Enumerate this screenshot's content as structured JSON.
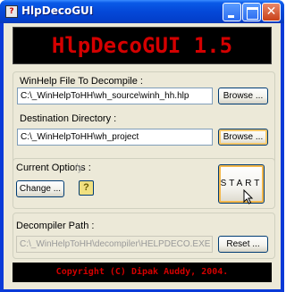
{
  "window": {
    "title": "HlpDecoGUI",
    "icon": "help-decompiler-icon",
    "controls": [
      "minimize-icon",
      "maximize-icon",
      "close-icon"
    ]
  },
  "banner": {
    "text": "HlpDecoGUI 1.5"
  },
  "winhelp_file": {
    "label": "WinHelp File To Decompile :",
    "value": "C:\\_WinHelpToHH\\wh_source\\winh_hh.hlp",
    "browse_label": "Browse ..."
  },
  "destination": {
    "label": "Destination Directory :",
    "value": "C:\\_WinHelpToHH\\wh_project",
    "browse_label": "Browse ..."
  },
  "options": {
    "label": "Current Options :",
    "value": "/y",
    "change_label": "Change ...",
    "help_label": "?"
  },
  "start": {
    "label": "START"
  },
  "decompiler": {
    "label": "Decompiler Path :",
    "value": "C:\\_WinHelpToHH\\decompiler\\HELPDECO.EXE",
    "reset_label": "Reset ..."
  },
  "footer": {
    "copyright": "Copyright (C) Dipak Auddy, 2004."
  },
  "colors": {
    "banner_text": "#d40000",
    "banner_bg": "#000000",
    "titlebar": "#0448d8"
  }
}
